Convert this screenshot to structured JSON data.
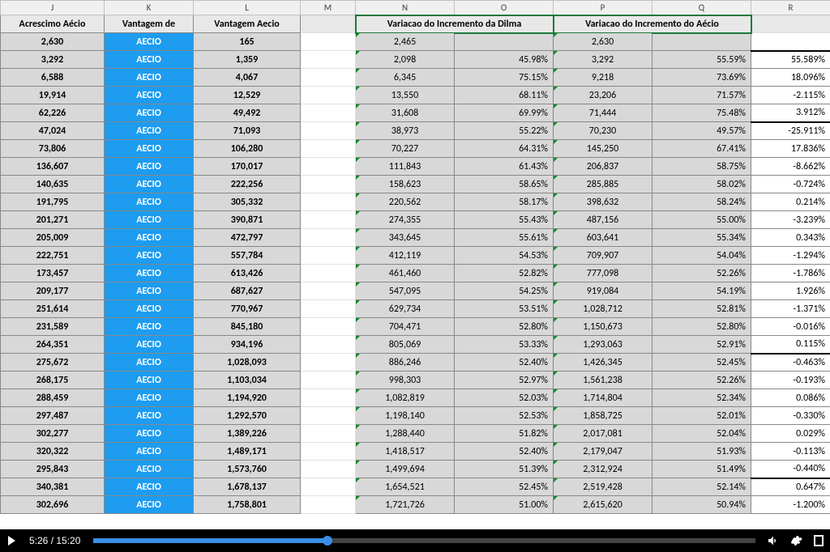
{
  "columns": [
    "J",
    "K",
    "L",
    "M",
    "N",
    "O",
    "P",
    "Q",
    "R"
  ],
  "headers": {
    "J": "Acrescimo Aécio",
    "K": "Vantagem de",
    "L": "Vantagem Aecio",
    "NO": "Variacao do Incremento da Dilma",
    "PQ": "Variacao do Incremento do Aécio"
  },
  "blue_label": "AECIO",
  "rows": [
    {
      "j": "2,630",
      "l": "165",
      "n": "2,465",
      "o": "",
      "p": "2,630",
      "q": "",
      "r": ""
    },
    {
      "j": "3,292",
      "l": "1,359",
      "n": "2,098",
      "o": "45.98%",
      "p": "3,292",
      "q": "55.59%",
      "r": "55.589%"
    },
    {
      "j": "6,588",
      "l": "4,067",
      "n": "6,345",
      "o": "75.15%",
      "p": "9,218",
      "q": "73.69%",
      "r": "18.096%"
    },
    {
      "j": "19,914",
      "l": "12,529",
      "n": "13,550",
      "o": "68.11%",
      "p": "23,206",
      "q": "71.57%",
      "r": "-2.115%"
    },
    {
      "j": "62,226",
      "l": "49,492",
      "n": "31,608",
      "o": "69.99%",
      "p": "71,444",
      "q": "75.48%",
      "r": "3.912%"
    },
    {
      "j": "47,024",
      "l": "71,093",
      "n": "38,973",
      "o": "55.22%",
      "p": "70,230",
      "q": "49.57%",
      "r": "-25.911%"
    },
    {
      "j": "73,806",
      "l": "106,280",
      "n": "70,227",
      "o": "64.31%",
      "p": "145,250",
      "q": "67.41%",
      "r": "17.836%"
    },
    {
      "j": "136,607",
      "l": "170,017",
      "n": "111,843",
      "o": "61.43%",
      "p": "206,837",
      "q": "58.75%",
      "r": "-8.662%"
    },
    {
      "j": "140,635",
      "l": "222,256",
      "n": "158,623",
      "o": "58.65%",
      "p": "285,885",
      "q": "58.02%",
      "r": "-0.724%"
    },
    {
      "j": "191,795",
      "l": "305,332",
      "n": "220,562",
      "o": "58.17%",
      "p": "398,632",
      "q": "58.24%",
      "r": "0.214%"
    },
    {
      "j": "201,271",
      "l": "390,871",
      "n": "274,355",
      "o": "55.43%",
      "p": "487,156",
      "q": "55.00%",
      "r": "-3.239%"
    },
    {
      "j": "205,009",
      "l": "472,797",
      "n": "343,645",
      "o": "55.61%",
      "p": "603,641",
      "q": "55.34%",
      "r": "0.343%"
    },
    {
      "j": "222,751",
      "l": "557,784",
      "n": "412,119",
      "o": "54.53%",
      "p": "709,907",
      "q": "54.04%",
      "r": "-1.294%"
    },
    {
      "j": "173,457",
      "l": "613,426",
      "n": "461,460",
      "o": "52.82%",
      "p": "777,098",
      "q": "52.26%",
      "r": "-1.786%"
    },
    {
      "j": "209,177",
      "l": "687,627",
      "n": "547,095",
      "o": "54.25%",
      "p": "919,084",
      "q": "54.19%",
      "r": "1.926%"
    },
    {
      "j": "251,614",
      "l": "770,967",
      "n": "629,734",
      "o": "53.51%",
      "p": "1,028,712",
      "q": "52.81%",
      "r": "-1.371%"
    },
    {
      "j": "231,589",
      "l": "845,180",
      "n": "704,471",
      "o": "52.80%",
      "p": "1,150,673",
      "q": "52.80%",
      "r": "-0.016%"
    },
    {
      "j": "264,351",
      "l": "934,196",
      "n": "805,069",
      "o": "53.33%",
      "p": "1,293,063",
      "q": "52.91%",
      "r": "0.115%"
    },
    {
      "j": "275,672",
      "l": "1,028,093",
      "n": "886,246",
      "o": "52.40%",
      "p": "1,426,345",
      "q": "52.45%",
      "r": "-0.463%"
    },
    {
      "j": "268,175",
      "l": "1,103,034",
      "n": "998,303",
      "o": "52.97%",
      "p": "1,561,238",
      "q": "52.26%",
      "r": "-0.193%"
    },
    {
      "j": "288,459",
      "l": "1,194,920",
      "n": "1,082,819",
      "o": "52.03%",
      "p": "1,714,804",
      "q": "52.34%",
      "r": "0.086%"
    },
    {
      "j": "297,487",
      "l": "1,292,570",
      "n": "1,198,140",
      "o": "52.53%",
      "p": "1,858,725",
      "q": "52.01%",
      "r": "-0.330%"
    },
    {
      "j": "302,277",
      "l": "1,389,226",
      "n": "1,288,440",
      "o": "51.82%",
      "p": "2,017,081",
      "q": "52.04%",
      "r": "0.029%"
    },
    {
      "j": "320,322",
      "l": "1,489,171",
      "n": "1,418,517",
      "o": "52.40%",
      "p": "2,179,047",
      "q": "51.93%",
      "r": "-0.113%"
    },
    {
      "j": "295,843",
      "l": "1,573,760",
      "n": "1,499,694",
      "o": "51.39%",
      "p": "2,312,924",
      "q": "51.49%",
      "r": "-0.440%"
    },
    {
      "j": "340,381",
      "l": "1,678,137",
      "n": "1,654,521",
      "o": "52.45%",
      "p": "2,519,428",
      "q": "52.14%",
      "r": "0.647%"
    },
    {
      "j": "302,696",
      "l": "1,758,801",
      "n": "1,721,726",
      "o": "51.00%",
      "p": "2,615,620",
      "q": "50.94%",
      "r": "-1.200%"
    }
  ],
  "player": {
    "current": "5:26",
    "duration": "15:20",
    "progress_pct": 35.4
  },
  "col_widths": {
    "J": 128,
    "K": 110,
    "L": 132,
    "M": 68,
    "N": 122,
    "O": 122,
    "P": 122,
    "Q": 122,
    "R": 98
  }
}
